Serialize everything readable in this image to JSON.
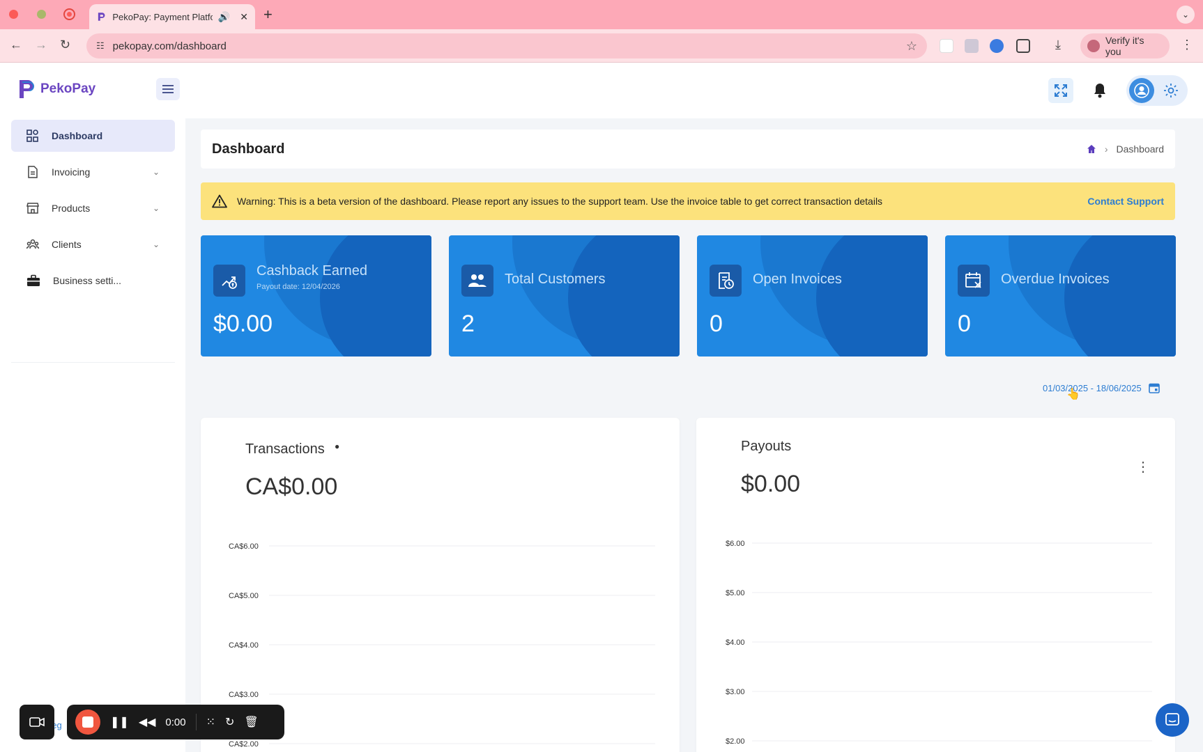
{
  "browser": {
    "tab_title": "PekoPay: Payment Platform",
    "url": "pekopay.com/dashboard",
    "verify_label": "Verify it's you"
  },
  "app": {
    "logo_text": "PekoPay"
  },
  "sidebar": {
    "items": [
      {
        "label": "Dashboard",
        "icon": "dashboard-icon",
        "active": true
      },
      {
        "label": "Invoicing",
        "icon": "invoice-icon",
        "chevron": true
      },
      {
        "label": "Products",
        "icon": "store-icon",
        "chevron": true
      },
      {
        "label": "Clients",
        "icon": "people-icon",
        "chevron": true
      },
      {
        "label": "Business setti...",
        "icon": "briefcase-icon"
      }
    ]
  },
  "page": {
    "title": "Dashboard",
    "breadcrumb_current": "Dashboard"
  },
  "warning": {
    "text": "Warning: This is a beta version of the dashboard. Please report any issues to the support team. Use the invoice table to get correct transaction details",
    "link": "Contact Support"
  },
  "stats": [
    {
      "label": "Cashback Earned",
      "sub": "Payout date: 12/04/2026",
      "value": "$0.00",
      "icon": "cashback-icon"
    },
    {
      "label": "Total Customers",
      "value": "2",
      "icon": "customers-icon"
    },
    {
      "label": "Open Invoices",
      "value": "0",
      "icon": "open-invoice-icon"
    },
    {
      "label": "Overdue Invoices",
      "value": "0",
      "icon": "overdue-calendar-icon"
    }
  ],
  "date_range": "01/03/2025 - 18/06/2025",
  "charts": {
    "transactions": {
      "title": "Transactions",
      "total": "CA$0.00"
    },
    "payouts": {
      "title": "Payouts",
      "total": "$0.00"
    }
  },
  "chart_data": [
    {
      "type": "line",
      "title": "Transactions",
      "y_ticks": [
        "CA$6.00",
        "CA$5.00",
        "CA$4.00",
        "CA$3.00",
        "CA$2.00"
      ],
      "y_tick_values": [
        6,
        5,
        4,
        3,
        2
      ],
      "grid": true,
      "series": []
    },
    {
      "type": "line",
      "title": "Payouts",
      "y_ticks": [
        "$6.00",
        "$5.00",
        "$4.00",
        "$3.00",
        "$2.00"
      ],
      "y_tick_values": [
        6,
        5,
        4,
        3,
        2
      ],
      "grid": true,
      "series": []
    }
  ],
  "recorder": {
    "time": "0:00"
  },
  "colors": {
    "accent": "#2088e2",
    "brand": "#6b46c1",
    "warning_bg": "#fce27c",
    "tabbar": "#fda9b7"
  }
}
